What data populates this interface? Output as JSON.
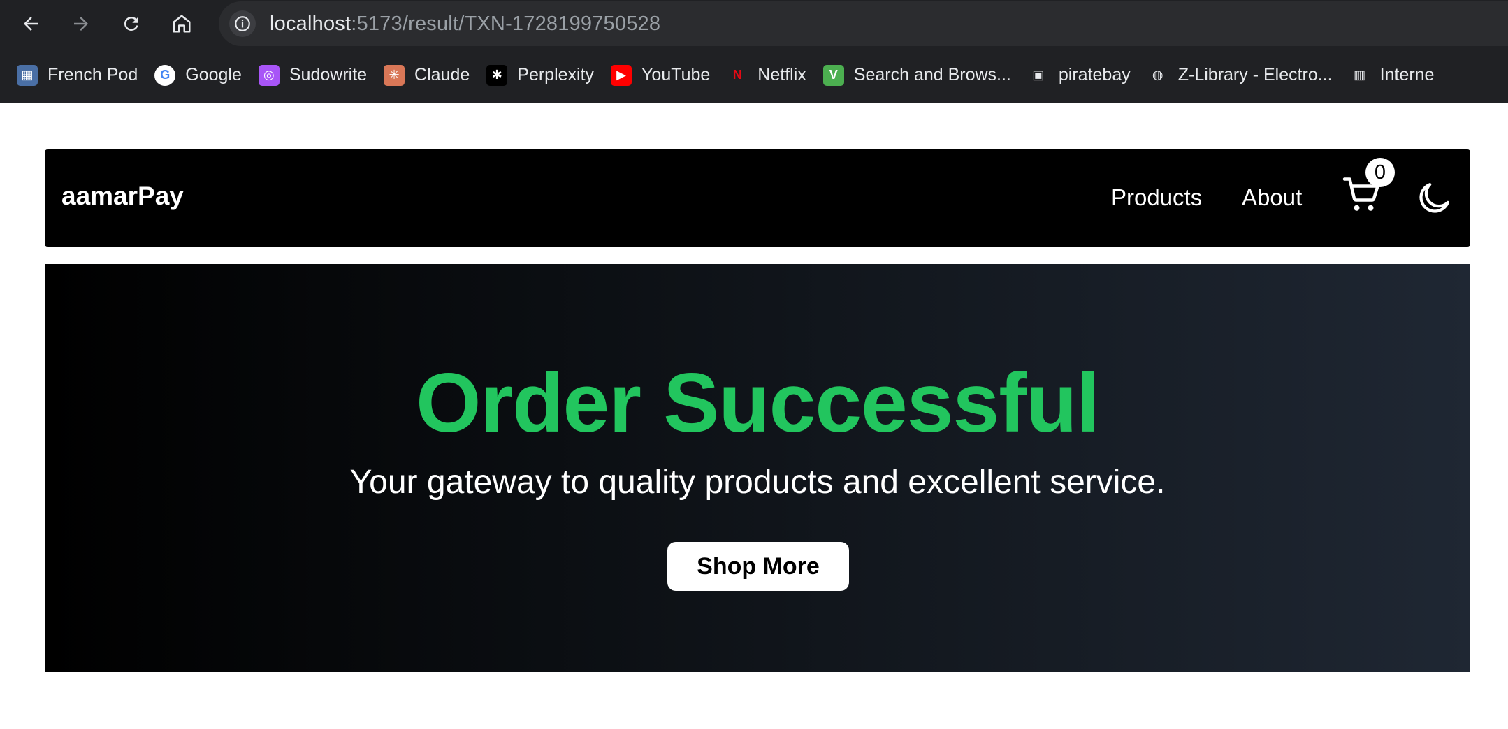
{
  "browser": {
    "url_host": "localhost",
    "url_path": ":5173/result/TXN-1728199750528",
    "bookmarks": [
      {
        "label": "French Pod",
        "icon": "french-pod-icon",
        "color": "#4a6fa5"
      },
      {
        "label": "Google",
        "icon": "google-icon",
        "color": "#ffffff"
      },
      {
        "label": "Sudowrite",
        "icon": "sudowrite-icon",
        "color": "#a855f7"
      },
      {
        "label": "Claude",
        "icon": "claude-icon",
        "color": "#d97757"
      },
      {
        "label": "Perplexity",
        "icon": "perplexity-icon",
        "color": "#000000"
      },
      {
        "label": "YouTube",
        "icon": "youtube-icon",
        "color": "#ff0000"
      },
      {
        "label": "Netflix",
        "icon": "netflix-icon",
        "color": "#e50914"
      },
      {
        "label": "Search and Brows...",
        "icon": "vts-icon",
        "color": "#4caf50"
      },
      {
        "label": "piratebay",
        "icon": "piratebay-icon",
        "color": "#ffffff"
      },
      {
        "label": "Z-Library - Electro...",
        "icon": "globe-icon",
        "color": "#ffffff"
      },
      {
        "label": "Interne",
        "icon": "archive-icon",
        "color": "#ffffff"
      }
    ]
  },
  "navbar": {
    "brand": "aamarPay",
    "links": [
      "Products",
      "About"
    ],
    "cart_count": "0"
  },
  "hero": {
    "title": "Order Successful",
    "subtitle": "Your gateway to quality products and excellent service.",
    "button": "Shop More",
    "title_color": "#22c55e"
  }
}
